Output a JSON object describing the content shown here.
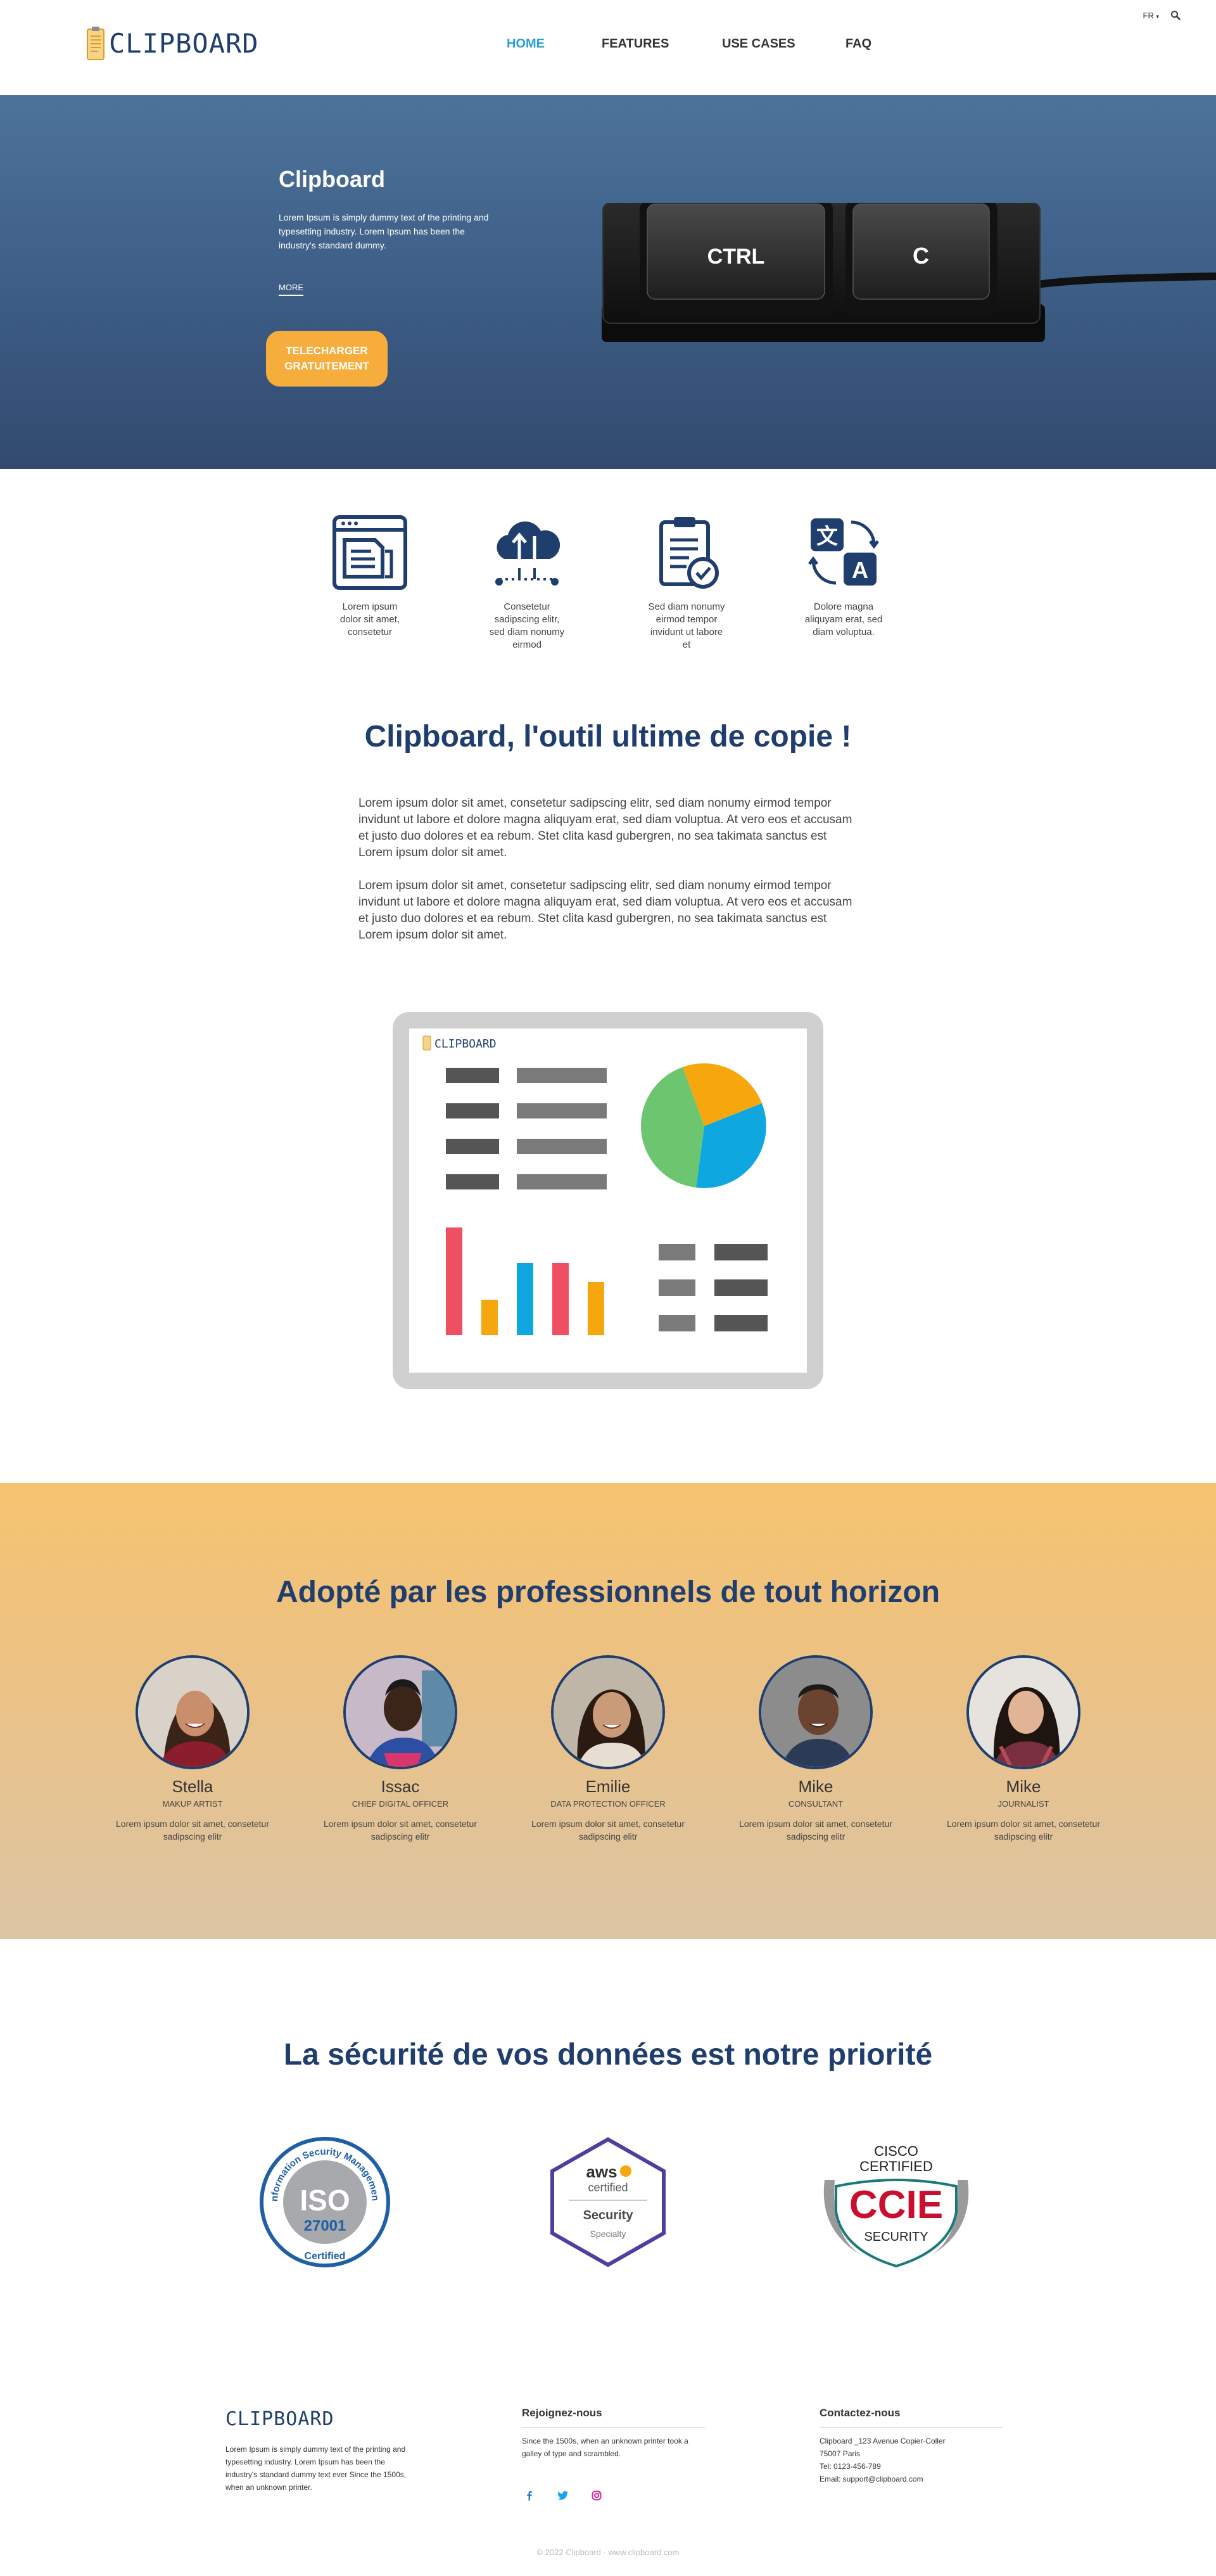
{
  "header": {
    "logo_text": "CLIPBOARD",
    "nav": [
      {
        "label": "HOME",
        "active": true
      },
      {
        "label": "FEATURES",
        "active": false
      },
      {
        "label": "USE CASES",
        "active": false
      },
      {
        "label": "FAQ",
        "active": false
      }
    ],
    "lang": "FR",
    "search_icon": "search-icon"
  },
  "hero": {
    "title": "Clipboard",
    "description": "Lorem Ipsum is simply dummy text of the printing and typesetting industry. Lorem Ipsum has been the industry's standard dummy.",
    "more": "MORE",
    "cta_line1": "TELECHARGER",
    "cta_line2": "GRATUITEMENT",
    "key1": "CTRL",
    "key2": "C"
  },
  "features": [
    {
      "icon": "browser-documents-icon",
      "text": "Lorem ipsum dolor sit amet, consetetur"
    },
    {
      "icon": "cloud-transfer-icon",
      "text": "Consetetur sadipscing elitr, sed diam nonumy eirmod"
    },
    {
      "icon": "clipboard-check-icon",
      "text": "Sed diam nonumy eirmod tempor invidunt ut labore et"
    },
    {
      "icon": "translate-icon",
      "text": "Dolore magna aliquyam erat, sed diam voluptua."
    }
  ],
  "about": {
    "title": "Clipboard, l'outil ultime de copie !",
    "p1": "Lorem ipsum dolor sit amet, consetetur sadipscing elitr, sed diam nonumy eirmod tempor invidunt ut labore et dolore magna aliquyam erat, sed diam voluptua. At vero eos et accusam et justo duo dolores et ea rebum. Stet clita kasd gubergren, no sea takimata sanctus est Lorem ipsum dolor sit amet.",
    "p2": "Lorem ipsum dolor sit amet, consetetur sadipscing elitr, sed diam nonumy eirmod tempor invidunt ut labore et dolore magna aliquyam erat, sed diam voluptua. At vero eos et accusam et justo duo dolores et ea rebum. Stet clita kasd gubergren, no sea takimata sanctus est Lorem ipsum dolor sit amet."
  },
  "dashboard": {
    "logo_text": "CLIPBOARD",
    "colors": {
      "green": "#6cc56f",
      "orange": "#f6a70d",
      "blue": "#0fa7e0",
      "red": "#ef4f62"
    }
  },
  "pros": {
    "title": "Adopté par les professionnels de tout horizon",
    "people": [
      {
        "name": "Stella",
        "role": "MAKUP ARTIST",
        "text": "Lorem ipsum dolor sit amet, consetetur sadipscing elitr"
      },
      {
        "name": "Issac",
        "role": "CHIEF DIGITAL OFFICER",
        "text": "Lorem ipsum dolor sit amet, consetetur sadipscing elitr"
      },
      {
        "name": "Emilie",
        "role": "DATA PROTECTION OFFICER",
        "text": "Lorem ipsum dolor sit amet, consetetur sadipscing elitr"
      },
      {
        "name": "Mike",
        "role": "CONSULTANT",
        "text": "Lorem ipsum dolor sit amet, consetetur sadipscing elitr"
      },
      {
        "name": "Mike",
        "role": "JOURNALIST",
        "text": "Lorem ipsum dolor sit amet, consetetur sadipscing elitr"
      }
    ]
  },
  "security": {
    "title": "La sécurité de vos données est notre priorité",
    "iso": {
      "arc_top": "Information Security Management",
      "big": "ISO",
      "num": "27001",
      "bottom": "Certified"
    },
    "aws": {
      "brand": "aws",
      "certified": "certified",
      "name": "Security",
      "specialty": "Specialty"
    },
    "cisco": {
      "line1": "CISCO",
      "line2": "CERTIFIED",
      "big": "CCIE",
      "bottom": "SECURITY"
    }
  },
  "footer": {
    "logo_text": "CLIPBOARD",
    "desc": "Lorem Ipsum is simply dummy text of the printing and typesetting industry. Lorem Ipsum has been the industry's standard dummy text ever Since the 1500s, when an unknown printer.",
    "join_title": "Rejoignez-nous",
    "join_text": "Since the 1500s, when an unknown printer took a galley of type and scrambled.",
    "contact_title": "Contactez-nous",
    "address1": "Clipboard _123 Avenue Copier-Coller",
    "address2": "75007 Paris",
    "tel": "Tel: 0123-456-789",
    "email": "Email: support@clipboard.com",
    "copyright": "© 2022 Clipboard - www.clipboard.com"
  }
}
